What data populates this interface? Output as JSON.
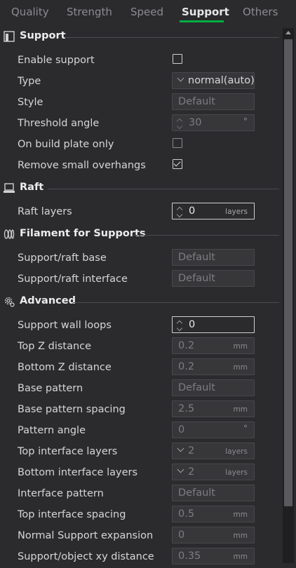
{
  "tabs": [
    "Quality",
    "Strength",
    "Speed",
    "Support",
    "Others"
  ],
  "active_tab": "Support",
  "accent_color": "#00ae42",
  "sections": {
    "support": {
      "title": "Support",
      "icon": "support-icon",
      "rows": {
        "enable_support": {
          "label": "Enable support",
          "checked": false
        },
        "type": {
          "label": "Type",
          "value": "normal(auto)"
        },
        "style": {
          "label": "Style",
          "value": "Default"
        },
        "threshold_angle": {
          "label": "Threshold angle",
          "value": "30",
          "unit": "°"
        },
        "on_build_plate_only": {
          "label": "On build plate only",
          "checked": false
        },
        "remove_small_overhangs": {
          "label": "Remove small overhangs",
          "checked": true
        }
      }
    },
    "raft": {
      "title": "Raft",
      "icon": "raft-icon",
      "rows": {
        "raft_layers": {
          "label": "Raft layers",
          "value": "0",
          "unit": "layers"
        }
      }
    },
    "filament": {
      "title": "Filament for Supports",
      "icon": "filament-icon",
      "rows": {
        "support_raft_base": {
          "label": "Support/raft base",
          "value": "Default"
        },
        "support_raft_interface": {
          "label": "Support/raft interface",
          "value": "Default"
        }
      }
    },
    "advanced": {
      "title": "Advanced",
      "icon": "advanced-gear-icon",
      "rows": {
        "support_wall_loops": {
          "label": "Support wall loops",
          "value": "0"
        },
        "top_z_distance": {
          "label": "Top Z distance",
          "value": "0.2",
          "unit": "mm"
        },
        "bottom_z_distance": {
          "label": "Bottom Z distance",
          "value": "0.2",
          "unit": "mm"
        },
        "base_pattern": {
          "label": "Base pattern",
          "value": "Default"
        },
        "base_pattern_spacing": {
          "label": "Base pattern spacing",
          "value": "2.5",
          "unit": "mm"
        },
        "pattern_angle": {
          "label": "Pattern angle",
          "value": "0",
          "unit": "°"
        },
        "top_interface_layers": {
          "label": "Top interface layers",
          "value": "2",
          "unit": "layers"
        },
        "bottom_interface_layers": {
          "label": "Bottom interface layers",
          "value": "2",
          "unit": "layers"
        },
        "interface_pattern": {
          "label": "Interface pattern",
          "value": "Default"
        },
        "top_interface_spacing": {
          "label": "Top interface spacing",
          "value": "0.5",
          "unit": "mm"
        },
        "normal_support_expansion": {
          "label": "Normal Support expansion",
          "value": "0",
          "unit": "mm"
        },
        "support_object_xy_distance": {
          "label": "Support/object xy distance",
          "value": "0.35",
          "unit": "mm"
        }
      }
    }
  }
}
